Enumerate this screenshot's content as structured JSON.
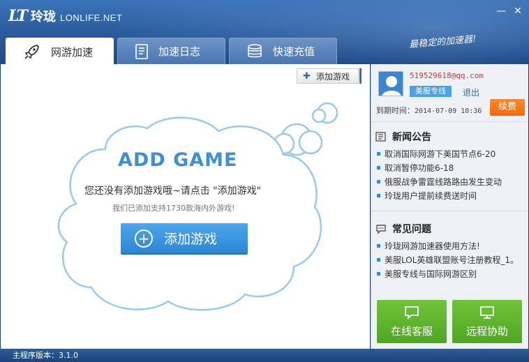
{
  "header": {
    "logo_mark": "LT",
    "logo_cn": "玲珑",
    "logo_en": "LONLIFE.NET",
    "slogan": "最稳定的加速器!",
    "minimize": "—",
    "close": "✕"
  },
  "tabs": [
    {
      "label": "网游加速",
      "icon": "rocket-icon",
      "active": true
    },
    {
      "label": "加速日志",
      "icon": "log-icon",
      "active": false
    },
    {
      "label": "快速充值",
      "icon": "coins-icon",
      "active": false
    }
  ],
  "main": {
    "add_game_small": "添加游戏",
    "add_game_title": "ADD GAME",
    "empty_message": "您还没有添加游戏哦~请点击 \"添加游戏\"",
    "support_message": "我们已添加支持1730款海内外游戏!",
    "add_game_big": "添加游戏"
  },
  "account": {
    "email": "519529618@qq.com",
    "plan": "美服专线",
    "logout": "退出",
    "expiry_label": "到期时间：",
    "expiry_value": "2014-07-09 10:36",
    "renew": "续费"
  },
  "news": {
    "title": "新闻公告",
    "items": [
      "取消国际网游下美国节点6-20",
      "取消暂停功能6-18",
      "俄服战争雷霆线路路由发生变动",
      "玲珑用户提前续费送时间"
    ]
  },
  "faq": {
    "title": "常见问题",
    "items": [
      "玲珑网游加速器使用方法!",
      "美服LOL英雄联盟账号注册教程_1。",
      "美服专线与国际网游区别"
    ]
  },
  "support": {
    "online": "在线客服",
    "remote": "远程协助"
  },
  "footer": {
    "version": "主程序版本：3.1.0"
  },
  "colors": {
    "header_blue": "#2c5f9f",
    "accent_blue": "#3a86d0",
    "renew_orange": "#f06a0c",
    "support_green": "#4fa624",
    "email_red": "#d03a3a"
  }
}
